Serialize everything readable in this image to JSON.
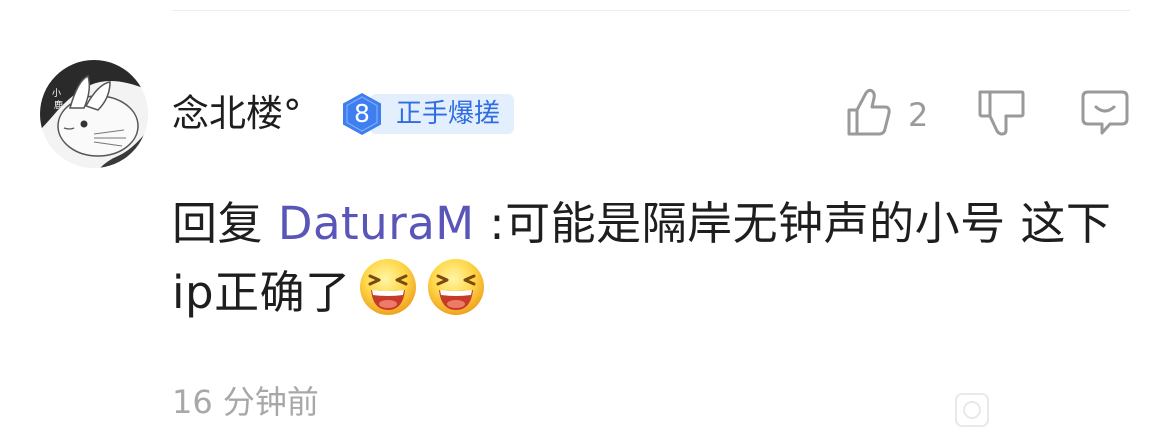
{
  "comment": {
    "username": "念北楼°",
    "level": {
      "number": "8",
      "label": "正手爆搓"
    },
    "likes": {
      "count": "2",
      "icon": "thumbs-up-icon"
    },
    "dislike_icon": "thumbs-down-icon",
    "reply_icon": "speech-bubble-icon",
    "reply_prefix": "回复 ",
    "reply_to": "DaturaM",
    "text": " :可能是隔岸无钟声的小号 这下ip正确了",
    "emoji_icon": "grinning-squint-emoji",
    "emoji_count": 2,
    "time": "16 分钟前"
  },
  "colors": {
    "username": "#1e1e1e",
    "reply_user": "#5a55b8",
    "badge_fill": "#3d7ef0",
    "badge_bg": "#e3effd",
    "badge_text": "#2f6de0",
    "icon_gray": "#9a9a9a",
    "time": "#a8a8a8"
  }
}
